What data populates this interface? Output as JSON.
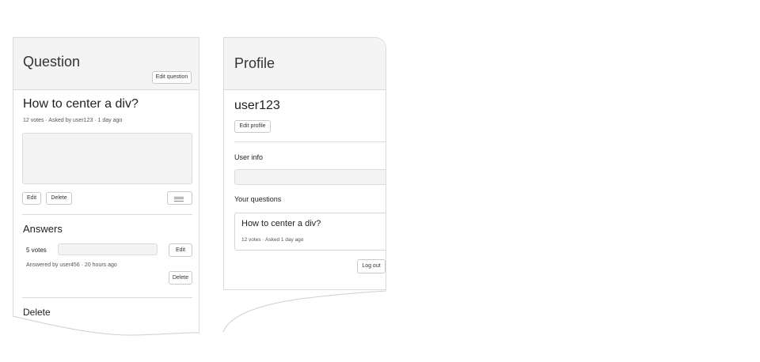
{
  "question_panel": {
    "header_title": "Question",
    "edit_question_label": "Edit question",
    "question_title": "How to center a div?",
    "meta": "12 votes · Asked by user123 · 1 day ago",
    "edit_label": "Edit",
    "delete_label": "Delete",
    "answers_heading": "Answers",
    "answer": {
      "votes": "5 votes",
      "edit_label": "Edit",
      "meta": "Answered by user456 · 20 hours ago",
      "delete_label": "Delete"
    },
    "bottom_heading": "Delete"
  },
  "profile_panel": {
    "header_title": "Profile",
    "username": "user123",
    "edit_profile_label": "Edit profile",
    "user_info_label": "User info",
    "your_questions_label": "Your questions",
    "question_card": {
      "title": "How to center a div?",
      "meta": "12 votes · Asked 1 day ago"
    },
    "logout_label": "Log out"
  },
  "colors": {
    "header_bg": "#f4f4f4",
    "border": "#dadada",
    "placeholder_bg": "#f3f3f3"
  }
}
